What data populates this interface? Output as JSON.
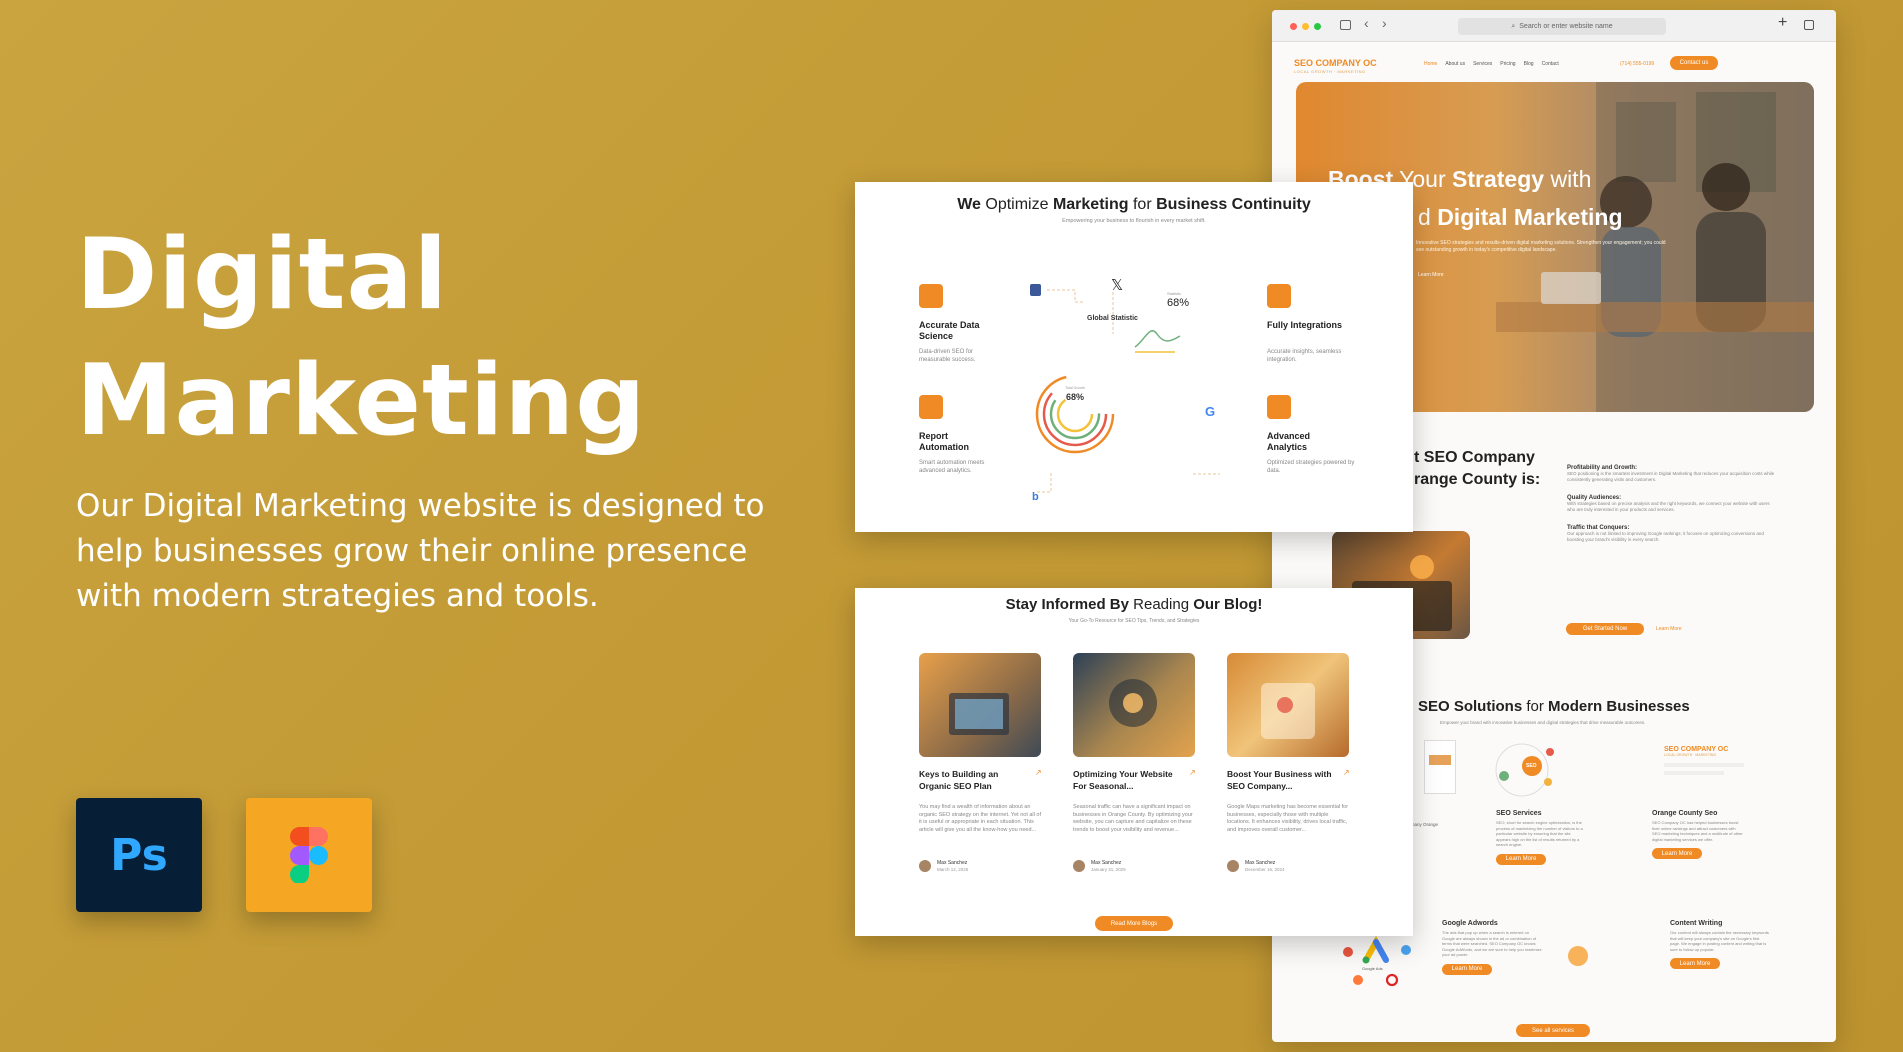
{
  "hero": {
    "title_line1": "Digital",
    "title_line2": "Marketing",
    "description": "Our Digital Marketing website is designed to help businesses grow their online presence with modern strategies and tools."
  },
  "tools": {
    "ps_label": "Ps"
  },
  "browser": {
    "url_placeholder": "Search or enter website name",
    "logo": "SEO COMPANY OC",
    "logo_sub": "LOCAL GROWTH · MARKETING",
    "nav": [
      "Home",
      "About us",
      "Services",
      "Pricing",
      "Blog",
      "Contact"
    ],
    "phone": "(714) 555-0199",
    "cta": "Contact us",
    "hero_line1_a": "Boost",
    "hero_line1_b": " Your ",
    "hero_line1_c": "Strategy",
    "hero_line1_d": " with",
    "hero_line2_a": "d ",
    "hero_line2_b": "Digital Marketing",
    "hero_text": "Innovative SEO strategies and results-driven digital marketing solutions. Strengthen your engagement; you could see outstanding growth in today's competitive digital landscape.",
    "learn_more": "Learn More",
    "about_title_1": "t SEO Company",
    "about_title_2": "range County is:",
    "about_items": [
      {
        "title": "Profitability and Growth:",
        "text": "SEO positioning is the smartest investment in Digital Marketing that reduces your acquisition costs while consistently generating visits and customers."
      },
      {
        "title": "Quality Audiences:",
        "text": "With strategies based on precise analysis and the right keywords, we connect your website with users who are truly interested in your products and services."
      },
      {
        "title": "Traffic that Conquers:",
        "text": "Our approach is not limited to improving Google rankings; it focuses on optimizing conversions and boosting your brand's visibility in every search."
      }
    ],
    "about_btn": "Get Started Now",
    "about_link": "Learn More",
    "solutions_title_a": "SEO Solutions",
    "solutions_title_b": " for ",
    "solutions_title_c": "Modern Businesses",
    "solutions_sub": "Empower your brand with innovative businesses and digital strategies that drive measurable outcomes.",
    "services": [
      {
        "title": "SEO Services",
        "text": "SEO, short for search engine optimization, is the process of maximizing the number of visitors to a particular website by ensuring that the site appears high on the list of results returned by a search engine.",
        "btn": "Learn More"
      },
      {
        "title": "Orange County Seo",
        "text": "SEO Company OC has helped businesses boost their online rankings and attract customers with SEO marketing techniques and a multitude of other digital marketing services we offer.",
        "btn": "Learn More"
      },
      {
        "title": "Google Adwords",
        "text": "The ads that pop up when a search is entered on Google are always shown in the ad or combination of terms that were searched. SEO Company OC knows Google AdWords, and we are sure to help you maximize your ad power.",
        "btn": "Learn More"
      },
      {
        "title": "Content Writing",
        "text": "Our content will always contain the necessary keywords that will keep your company's site on Google's first page. We engage in posting content and writing that is sure to follow up popular.",
        "btn": "Learn More"
      }
    ],
    "partial_service_text": "pany Orange",
    "google_ads_label": "Google Ads",
    "see_all_btn": "See all services",
    "seo_badge": "SEO"
  },
  "features_card": {
    "title_a": "We",
    "title_b": " Optimize ",
    "title_c": "Marketing",
    "title_d": " for ",
    "title_e": "Business Continuity",
    "subtitle": "Empowering your business to flourish in every market shift.",
    "features": [
      {
        "title": "Accurate Data Science",
        "text": "Data-driven SEO for measurable success."
      },
      {
        "title": "Report Automation",
        "text": "Smart automation meets advanced analytics."
      },
      {
        "title": "Fully Integrations",
        "text": "Accurate insights, seamless integration."
      },
      {
        "title": "Advanced Analytics",
        "text": "Optimized strategies powered by data."
      }
    ],
    "global_statistic": "Global Statistic",
    "stat_small_label": "Statistic",
    "stat_value": "68%",
    "ring_label": "Total Growth",
    "ring_value": "68%"
  },
  "blog_card": {
    "title_a": "Stay Informed By",
    "title_b": " Reading ",
    "title_c": "Our Blog!",
    "subtitle": "Your Go-To Resource for SEO Tips, Trends, and Strategies",
    "posts": [
      {
        "title": "Keys to Building an Organic SEO Plan",
        "text": "You may find a wealth of information about an organic SEO strategy on the internet. Yet not all of it is useful or appropriate in each situation. This article will give you all the know-how you need...",
        "author": "Max Sanchez",
        "date": "March 12, 2025"
      },
      {
        "title": "Optimizing Your Website For Seasonal...",
        "text": "Seasonal traffic can have a significant impact on businesses in Orange County. By optimizing your website, you can capture and capitalize on these trends to boost your visibility and revenue...",
        "author": "Max Sanchez",
        "date": "January 31, 2025"
      },
      {
        "title": "Boost Your Business with SEO Company...",
        "text": "Google Maps marketing has become essential for businesses, especially those with multiple locations. It enhances visibility, drives local traffic, and improves overall customer...",
        "author": "Max Sanchez",
        "date": "December 16, 2024"
      }
    ],
    "read_more": "Read More Blogs"
  },
  "colors": {
    "accent": "#f08a24",
    "background": "#c6a03b",
    "ps_bg": "#061e36",
    "ps_text": "#31a8ff",
    "figma_bg": "#f5a623"
  }
}
